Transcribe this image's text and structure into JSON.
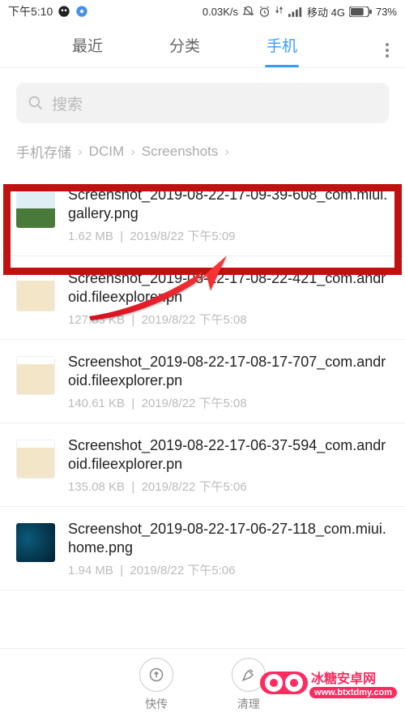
{
  "status": {
    "time": "下午5:10",
    "speed": "0.03K/s",
    "carrier": "移动 4G",
    "battery": "73%"
  },
  "tabs": {
    "recent": "最近",
    "category": "分类",
    "phone": "手机"
  },
  "search": {
    "placeholder": "搜索"
  },
  "breadcrumbs": {
    "a": "手机存储",
    "b": "DCIM",
    "c": "Screenshots"
  },
  "files": [
    {
      "name": "Screenshot_2019-08-22-17-09-39-608_com.miui.gallery.png",
      "size": "1.62 MB",
      "date": "2019/8/22 下午5:09",
      "thumb": "landscape"
    },
    {
      "name": "Screenshot_2019-08-22-17-08-22-421_com.android.fileexplorer.pn",
      "size": "127.83 KB",
      "date": "2019/8/22 下午5:08",
      "thumb": "doc"
    },
    {
      "name": "Screenshot_2019-08-22-17-08-17-707_com.android.fileexplorer.pn",
      "size": "140.61 KB",
      "date": "2019/8/22 下午5:08",
      "thumb": "doc"
    },
    {
      "name": "Screenshot_2019-08-22-17-06-37-594_com.android.fileexplorer.pn",
      "size": "135.08 KB",
      "date": "2019/8/22 下午5:06",
      "thumb": "doc"
    },
    {
      "name": "Screenshot_2019-08-22-17-06-27-118_com.miui.home.png",
      "size": "1.94 MB",
      "date": "2019/8/22 下午5:06",
      "thumb": "dark"
    }
  ],
  "bottom": {
    "send": "快传",
    "clean": "清理"
  },
  "watermark": {
    "brand": "冰糖安卓网",
    "url": "www.btxtdmy.com"
  }
}
